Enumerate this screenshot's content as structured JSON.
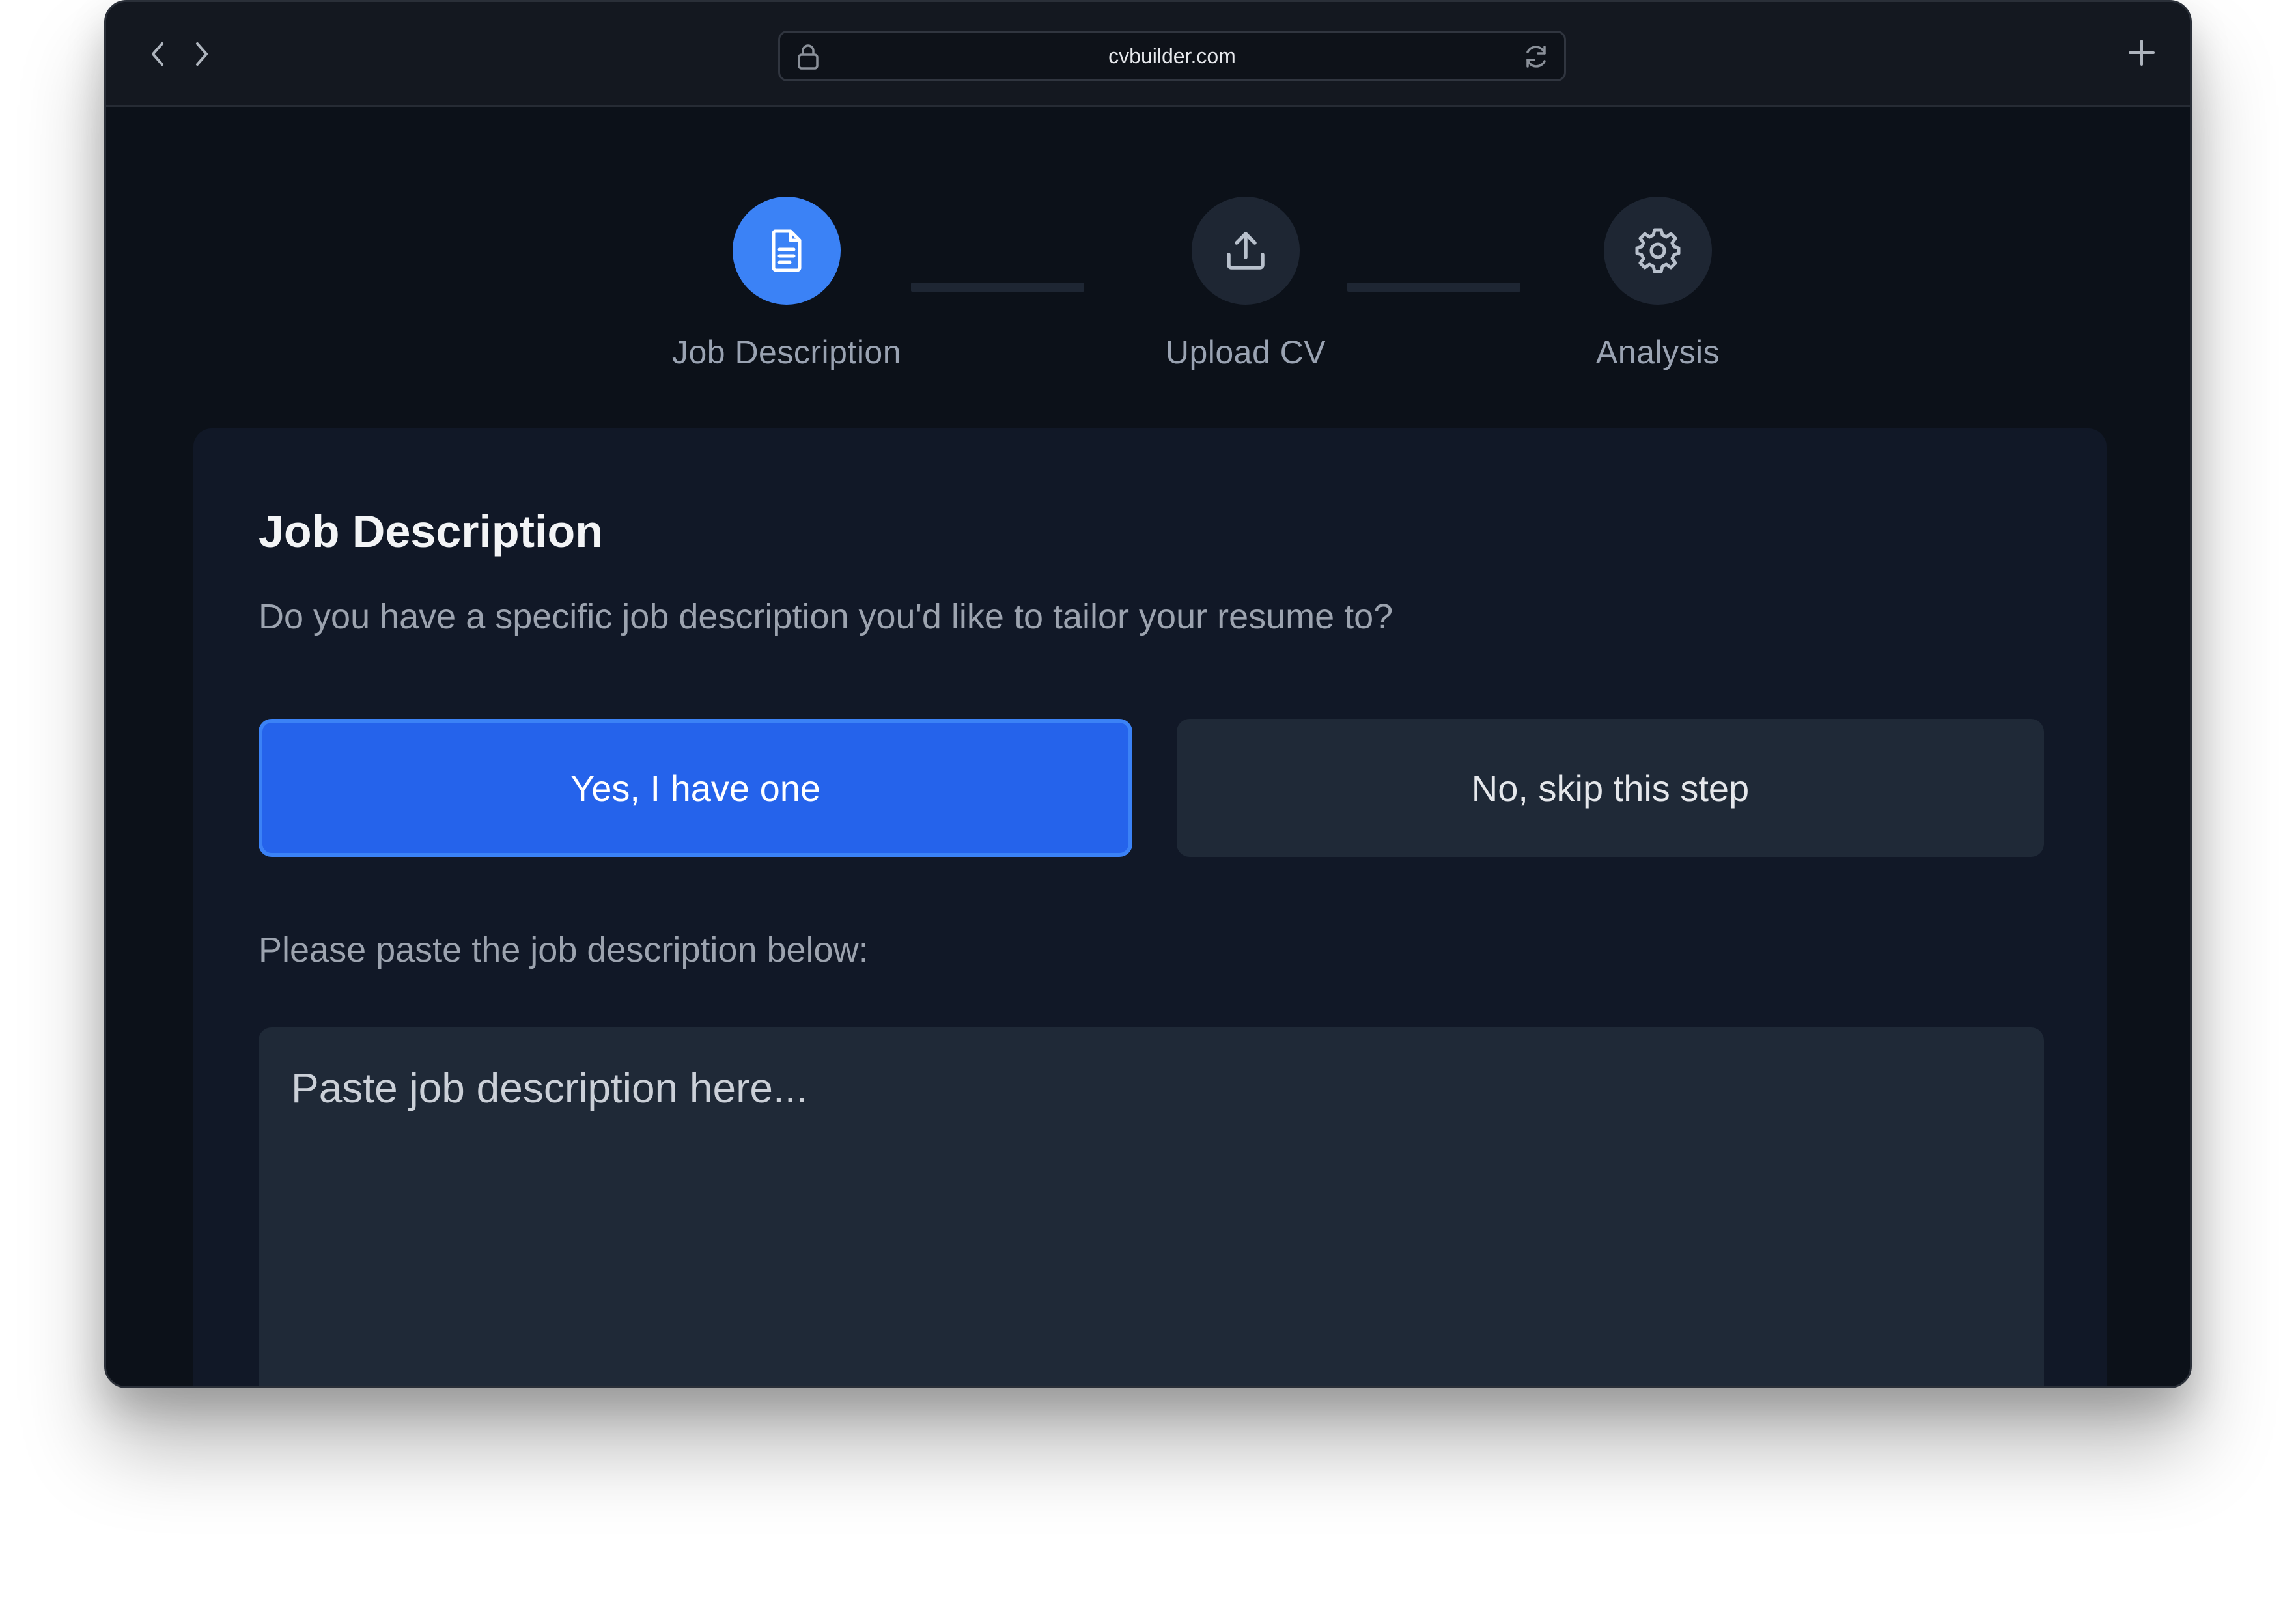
{
  "browser": {
    "url": "cvbuilder.com"
  },
  "steps": [
    {
      "label": "Job Description",
      "icon": "document-icon",
      "active": true
    },
    {
      "label": "Upload CV",
      "icon": "upload-icon",
      "active": false
    },
    {
      "label": "Analysis",
      "icon": "gear-icon",
      "active": false
    }
  ],
  "card": {
    "title": "Job Description",
    "question": "Do you have a specific job description you'd like to tailor your resume to?",
    "yes_label": "Yes, I have one",
    "no_label": "No, skip this step",
    "paste_label": "Please paste the job description below:",
    "textarea_placeholder": "Paste job description here..."
  },
  "colors": {
    "accent": "#2563eb",
    "active_step": "#3b82f6",
    "background": "#0c1119",
    "card": "#111827",
    "surface": "#1f2937"
  }
}
